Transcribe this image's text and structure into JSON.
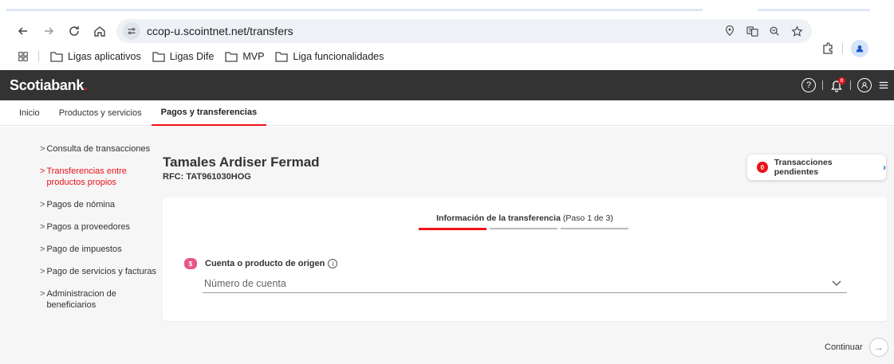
{
  "browser": {
    "url": "ccop-u.scointnet.net/transfers",
    "bookmarks": [
      "Ligas aplicativos",
      "Ligas Dife",
      "MVP",
      "Liga funcionalidades"
    ]
  },
  "header": {
    "logo": "Scotiabank",
    "logo_dot": ".",
    "notification_count": "0"
  },
  "topnav": {
    "items": [
      "Inicio",
      "Productos y servicios",
      "Pagos y transferencias"
    ]
  },
  "sidebar": {
    "items": [
      "Consulta de transacciones",
      "Transferencias entre productos propios",
      "Pagos de nómina",
      "Pagos a proveedores",
      "Pago de impuestos",
      "Pago de servicios y facturas",
      "Administracion de beneficiarios"
    ]
  },
  "customer": {
    "name": "Tamales Ardiser Fermad",
    "rfc": "RFC: TAT961030HOG"
  },
  "pending": {
    "count": "0",
    "label": "Transacciones pendientes"
  },
  "form": {
    "step_title": "Información de la transferencia",
    "step_progress": "(Paso 1 de 3)",
    "field_label": "Cuenta o producto de origen",
    "placeholder": "Número de cuenta"
  },
  "actions": {
    "continue": "Continuar"
  },
  "colors": {
    "brand_red": "#ec111a",
    "header_dark": "#333333",
    "link_blue": "#1e6ed8"
  }
}
